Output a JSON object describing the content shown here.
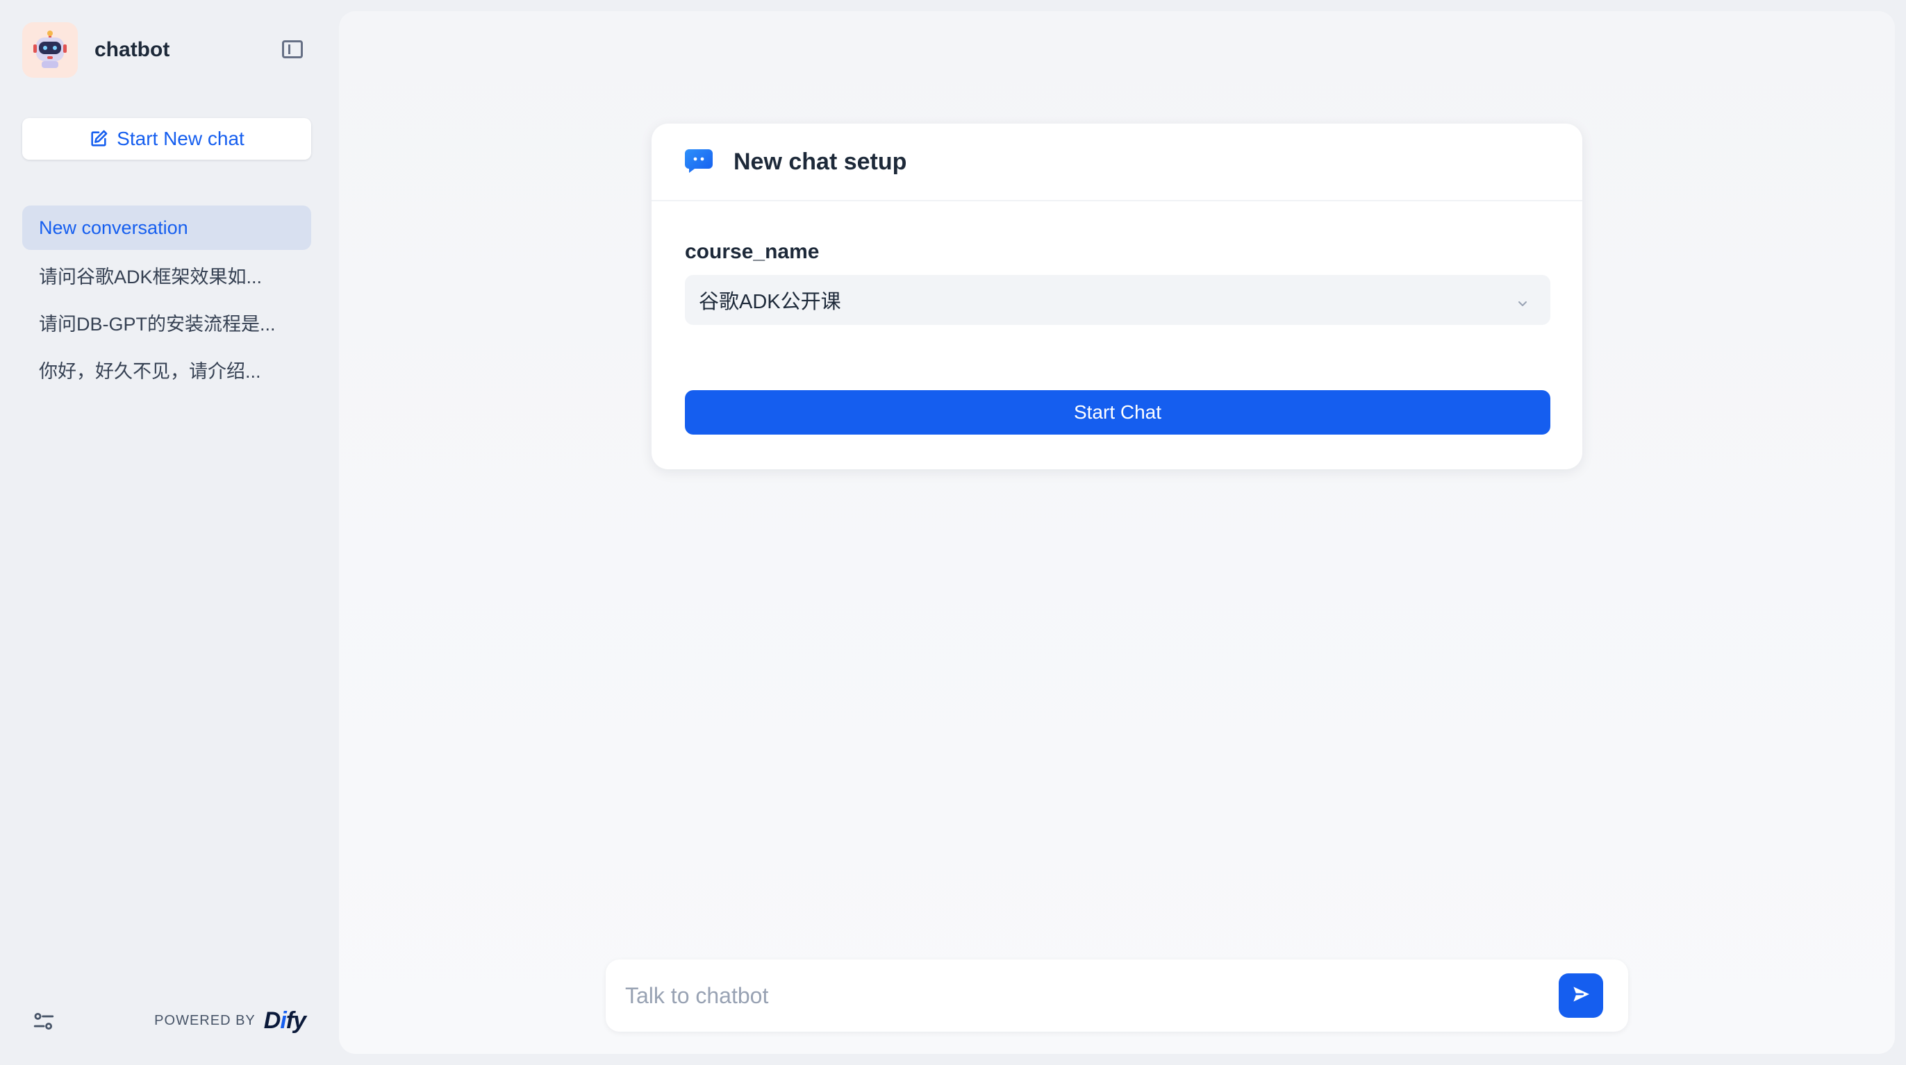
{
  "app": {
    "name": "chatbot",
    "accent_color": "#155eef",
    "logo_icon": "robot-avatar-icon"
  },
  "sidebar": {
    "new_chat_label": "Start New chat",
    "conversations": [
      {
        "label": "New conversation",
        "active": true
      },
      {
        "label": "请问谷歌ADK框架效果如...",
        "active": false
      },
      {
        "label": "请问DB-GPT的安装流程是...",
        "active": false
      },
      {
        "label": "你好，好久不见，请介绍...",
        "active": false
      }
    ],
    "powered_by_label": "POWERED BY",
    "powered_by_brand": "Dify"
  },
  "setup_card": {
    "title": "New chat setup",
    "field_label": "course_name",
    "selected_value": "谷歌ADK公开课",
    "start_button_label": "Start Chat"
  },
  "composer": {
    "placeholder": "Talk to chatbot",
    "value": ""
  }
}
